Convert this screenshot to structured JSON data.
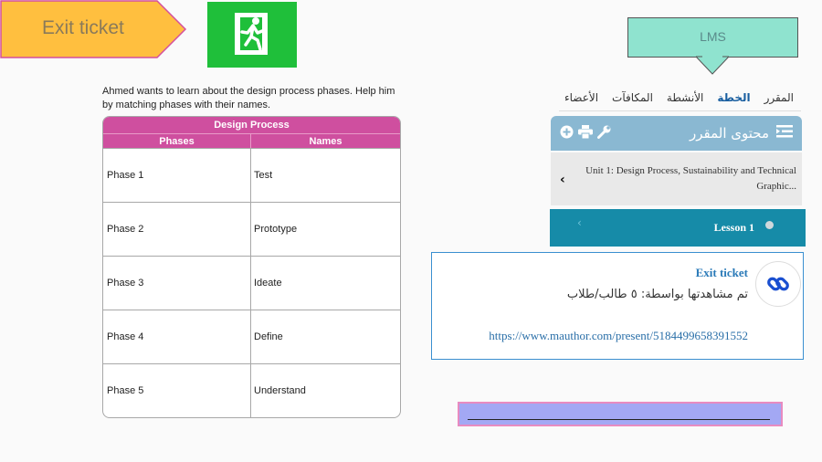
{
  "banner": {
    "label": "Exit ticket",
    "fill": "#ffbf3f",
    "stroke": "#d44f9e"
  },
  "exit_sign": {
    "icon": "emergency-exit-icon",
    "color": "#1fbf3a"
  },
  "lms_callout": {
    "label": "LMS"
  },
  "worksheet": {
    "question": "Ahmed wants to learn about the design process phases. Help him by matching phases with their names.",
    "table_title": "Design Process",
    "col_phases": "Phases",
    "col_names": "Names",
    "rows": [
      {
        "phase": "Phase 1",
        "name": "Test"
      },
      {
        "phase": "Phase 2",
        "name": "Prototype"
      },
      {
        "phase": "Phase 3",
        "name": "Ideate"
      },
      {
        "phase": "Phase 4",
        "name": "Define"
      },
      {
        "phase": "Phase 5",
        "name": "Understand"
      }
    ],
    "header_color": "#cf4f9f"
  },
  "lms": {
    "nav": [
      "المقرر",
      "الخطة",
      "الأنشطة",
      "المكافآت",
      "الأعضاء"
    ],
    "content_title": "محتوى المقرر",
    "unit_text": "Unit 1: Design Process, Sustainability and Technical Graphic...",
    "lesson_label": "Lesson 1",
    "ticket_title": "Exit ticket",
    "ticket_views": "تم مشاهدتها بواسطة: ٥ طالب/طلاب",
    "ticket_url": "https://www.mauthor.com/present/5184499658391552",
    "accent": "#168ba8"
  }
}
